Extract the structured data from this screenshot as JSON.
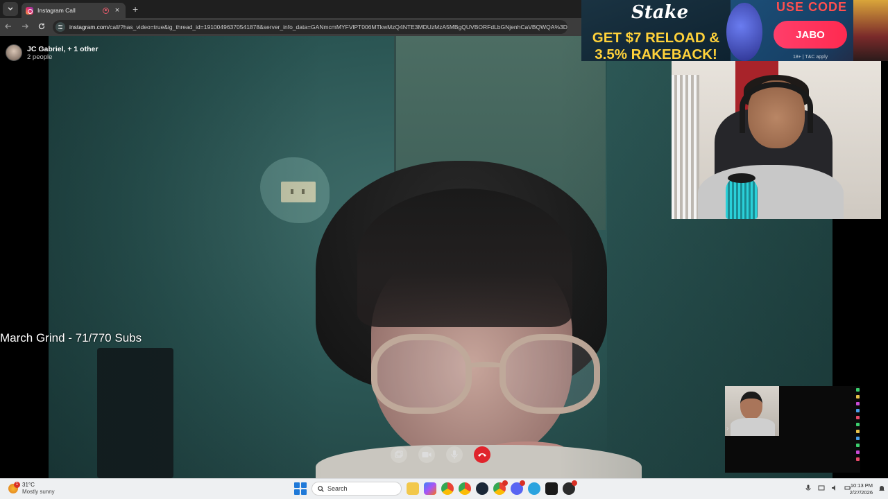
{
  "browser": {
    "tab_title": "Instagram Call",
    "new_tab_glyph": "+",
    "close_glyph": "×",
    "url_host": "instagram.com",
    "url_rest": "/call/?has_video=true&ig_thread_id=19100496370541878&server_info_data=GANmcmMYFVlPT006MTkwMzQ4NTE3MDUzMzA5MBgQUVBORFdLbGNjenhCaVBQWQA%3D"
  },
  "call": {
    "participants_title": "JC Gabriel, + 1 other",
    "participants_count": "2 people",
    "controls": [
      "screen-share-icon",
      "video-camera-icon",
      "microphone-icon",
      "end-call-icon"
    ]
  },
  "stream_overlay": {
    "goal_text": "March Grind - 71/770 Subs"
  },
  "ad": {
    "brand": "Stake",
    "headline_line1": "GET $7 RELOAD &",
    "headline_line2": "3.5% RAKEBACK!",
    "use_code_label": "USE CODE",
    "code": "JABO",
    "terms": "18+ | T&C apply",
    "colors": {
      "headline": "#ffd23a",
      "code_button": "#ff3e6a",
      "use_code": "#ff4f4f"
    }
  },
  "taskbar": {
    "weather_temp": "31°C",
    "weather_desc": "Mostly sunny",
    "weather_badge": "1",
    "search_placeholder": "Search",
    "time": "10:13 PM",
    "date": "2/27/2026",
    "apps": [
      "file-explorer-icon",
      "copilot-icon",
      "chrome-icon",
      "chrome-icon",
      "steam-icon",
      "chrome-icon",
      "discord-icon",
      "telegram-icon",
      "app-icon",
      "game-icon"
    ]
  },
  "colors": {
    "end_call": "#e0242c",
    "windows_accent": "#1f79d8"
  }
}
